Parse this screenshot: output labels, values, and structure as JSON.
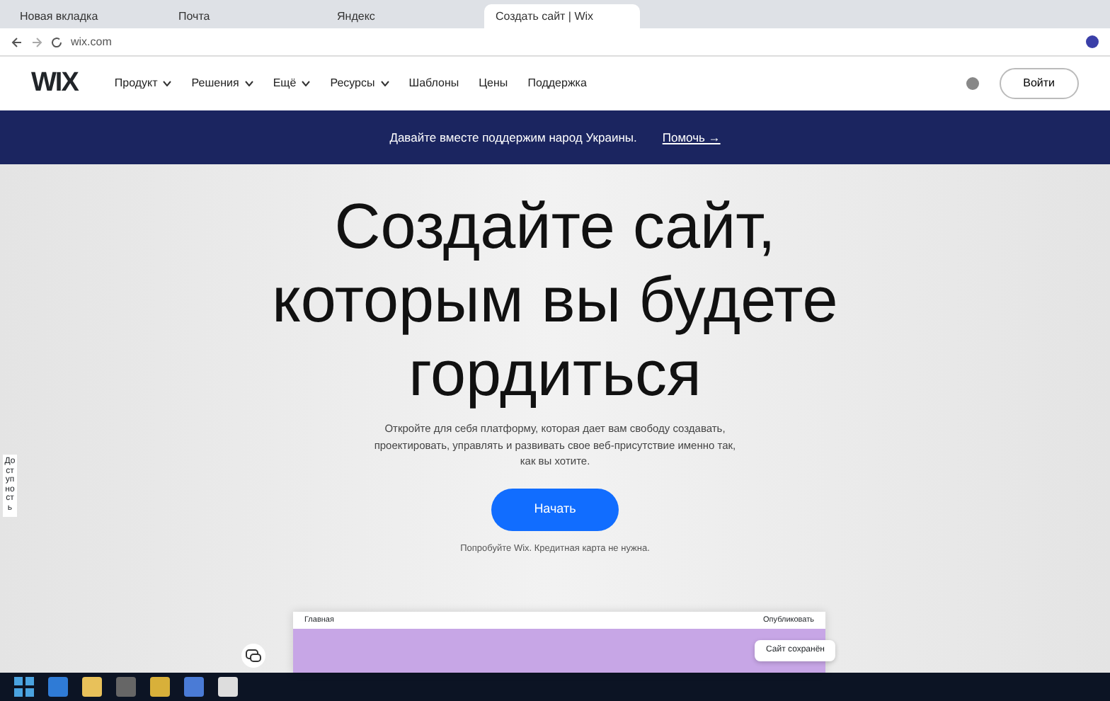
{
  "browser": {
    "tabs": [
      {
        "title": "Новая вкладка",
        "selected": false
      },
      {
        "title": "Почта",
        "selected": false
      },
      {
        "title": "Яндекс",
        "selected": false
      },
      {
        "title": "Создать сайт | Wix",
        "selected": true
      }
    ],
    "address": "wix.com"
  },
  "nav": {
    "logo": "WIX",
    "items": [
      {
        "label": "Продукт",
        "dropdown": true
      },
      {
        "label": "Решения",
        "dropdown": true
      },
      {
        "label": "Ещё",
        "dropdown": true
      },
      {
        "label": "Ресурсы",
        "dropdown": true
      },
      {
        "label": "Шаблоны",
        "dropdown": false
      },
      {
        "label": "Цены",
        "dropdown": false
      },
      {
        "label": "Поддержка",
        "dropdown": false
      }
    ],
    "button": "Войти"
  },
  "banner": {
    "text": "Давайте вместе поддержим народ Украины.",
    "link": "Помочь →"
  },
  "hero": {
    "title": "Создайте сайт, которым вы будете гордиться",
    "subtitle": "Откройте для себя платформу, которая дает вам свободу создавать, проектировать, управлять и развивать свое веб-присутствие именно так, как вы хотите.",
    "button": "Начать",
    "note": "Попробуйте Wix. Кредитная карта не нужна."
  },
  "side_tab": "Доступность",
  "preview": {
    "page": "Главная",
    "publish": "Опубликовать",
    "toast": "Сайт сохранён"
  }
}
